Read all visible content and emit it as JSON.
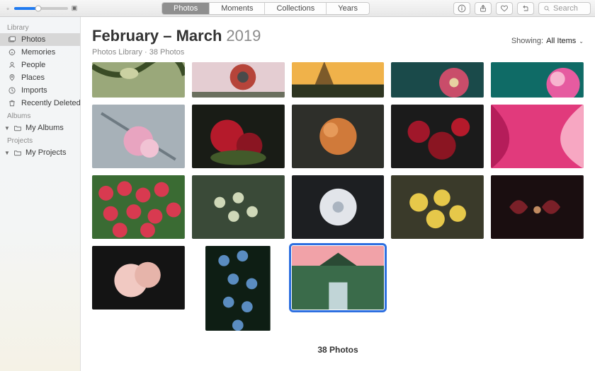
{
  "toolbar": {
    "tabs": [
      "Photos",
      "Moments",
      "Collections",
      "Years"
    ],
    "active_tab_index": 0,
    "search_placeholder": "Search"
  },
  "sidebar": {
    "sections": [
      {
        "heading": "Library",
        "items": [
          {
            "label": "Photos",
            "icon": "photo-stack-icon",
            "selected": true
          },
          {
            "label": "Memories",
            "icon": "memories-icon",
            "selected": false
          },
          {
            "label": "People",
            "icon": "person-icon",
            "selected": false
          },
          {
            "label": "Places",
            "icon": "pin-icon",
            "selected": false
          },
          {
            "label": "Imports",
            "icon": "clock-icon",
            "selected": false
          },
          {
            "label": "Recently Deleted",
            "icon": "trash-icon",
            "selected": false
          }
        ]
      },
      {
        "heading": "Albums",
        "items": [
          {
            "label": "My Albums",
            "icon": "folder-icon",
            "disclosure": true
          }
        ]
      },
      {
        "heading": "Projects",
        "items": [
          {
            "label": "My Projects",
            "icon": "folder-icon",
            "disclosure": true
          }
        ]
      }
    ]
  },
  "header": {
    "title_bold": "February – March",
    "title_light": "2019",
    "subtitle": "Photos Library · 38 Photos",
    "showing_label": "Showing:",
    "showing_value": "All Items"
  },
  "footer": {
    "count_label": "38 Photos"
  },
  "photos": {
    "row0": [
      {
        "name": "photo-branch",
        "palette": [
          "#9aa87a",
          "#3a4c26",
          "#cbd1a2"
        ]
      },
      {
        "name": "photo-bird",
        "palette": [
          "#e9b9c0",
          "#b6443a",
          "#6a6f5e"
        ]
      },
      {
        "name": "photo-sunset-tree",
        "palette": [
          "#f0b24a",
          "#7c5a2a",
          "#2e3521"
        ]
      },
      {
        "name": "photo-hibiscus",
        "palette": [
          "#1a4a4a",
          "#c94d6a",
          "#e7d1a1"
        ]
      },
      {
        "name": "photo-pink-flower",
        "palette": [
          "#0f6b66",
          "#e65ba0",
          "#f7b4cf"
        ]
      }
    ],
    "row1": [
      {
        "name": "photo-blossom-branch",
        "palette": [
          "#8d98a0",
          "#e8a4c0",
          "#b6bdc3"
        ]
      },
      {
        "name": "photo-red-roses",
        "palette": [
          "#191c16",
          "#b51a2b",
          "#6d8b3d"
        ]
      },
      {
        "name": "photo-orange-bloom",
        "palette": [
          "#2e2f2a",
          "#d07a3a",
          "#a14e2a"
        ]
      },
      {
        "name": "photo-red-rose-cluster",
        "palette": [
          "#1b1b1b",
          "#a0172a",
          "#5c6d3a"
        ]
      },
      {
        "name": "photo-pink-macro",
        "palette": [
          "#e13a7c",
          "#f7a7c2",
          "#b51d5a"
        ]
      }
    ],
    "row2": [
      {
        "name": "photo-tulip-field",
        "palette": [
          "#8e1d2f",
          "#d83a50",
          "#3a6b33"
        ]
      },
      {
        "name": "photo-wildflowers-bokeh",
        "palette": [
          "#3a4a38",
          "#cfd8b8",
          "#8a9a70"
        ]
      },
      {
        "name": "photo-white-bloom-dark",
        "palette": [
          "#1d1f22",
          "#e2e5ea",
          "#5a6a7a"
        ]
      },
      {
        "name": "photo-daffodils",
        "palette": [
          "#3a3a2a",
          "#e6c84a",
          "#a08a30"
        ]
      },
      {
        "name": "photo-dark-red-macro",
        "palette": [
          "#1a0e10",
          "#7a2028",
          "#c08a60"
        ]
      }
    ],
    "row3": [
      {
        "name": "photo-peonies",
        "palette": [
          "#141414",
          "#f1c9c2",
          "#d9a49a"
        ]
      },
      {
        "name": "photo-blue-flowers-portrait",
        "palette": [
          "#0e1e14",
          "#5a8cc0",
          "#a4c4e0"
        ]
      },
      {
        "name": "photo-waterfall-sunset",
        "palette": [
          "#f1a2a8",
          "#3a6b4a",
          "#6f7d86"
        ],
        "selected": true
      }
    ]
  }
}
